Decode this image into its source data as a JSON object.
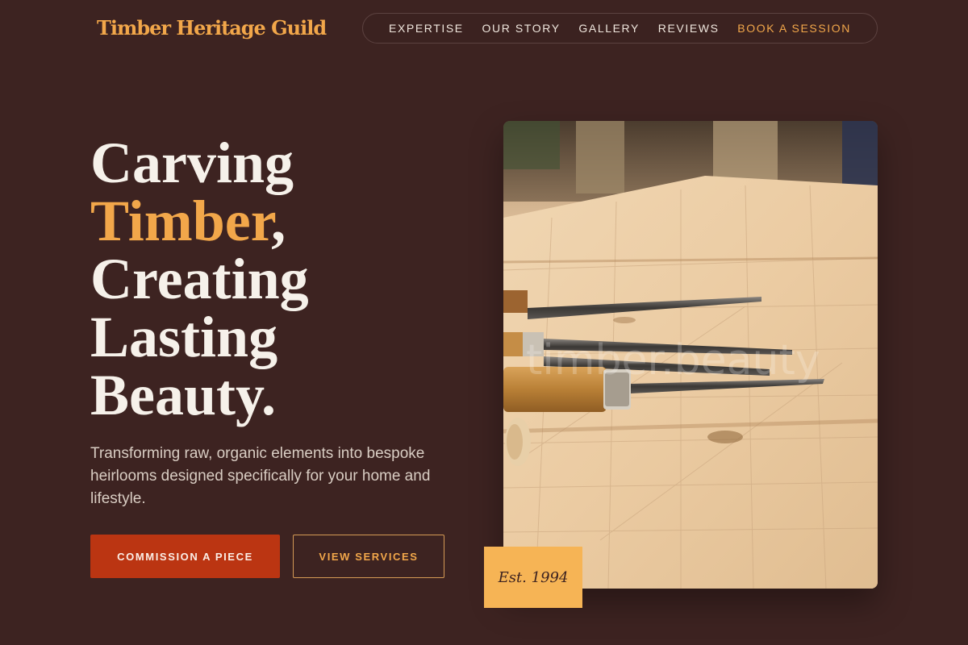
{
  "brand": {
    "name": "Timber Heritage Guild"
  },
  "nav": {
    "items": [
      {
        "label": "EXPERTISE"
      },
      {
        "label": "OUR STORY"
      },
      {
        "label": "GALLERY"
      },
      {
        "label": "REVIEWS"
      },
      {
        "label": "BOOK A SESSION"
      }
    ]
  },
  "hero": {
    "headline": {
      "line1": "Carving",
      "line2_accent": "Timber",
      "line2_suffix": ",",
      "line3": "Creating",
      "line4": "Lasting",
      "line5": "Beauty."
    },
    "lead": "Transforming raw, organic elements into bespoke heirlooms designed specifically for your home and lifestyle.",
    "primary_cta": "COMMISSION A PIECE",
    "secondary_cta": "VIEW SERVICES",
    "photo_watermark": "timber.beauty",
    "badge": "Est. 1994"
  },
  "colors": {
    "background": "#3d2321",
    "accent": "#f2a74a",
    "primary_button": "#bb3512",
    "badge": "#f6b455"
  }
}
